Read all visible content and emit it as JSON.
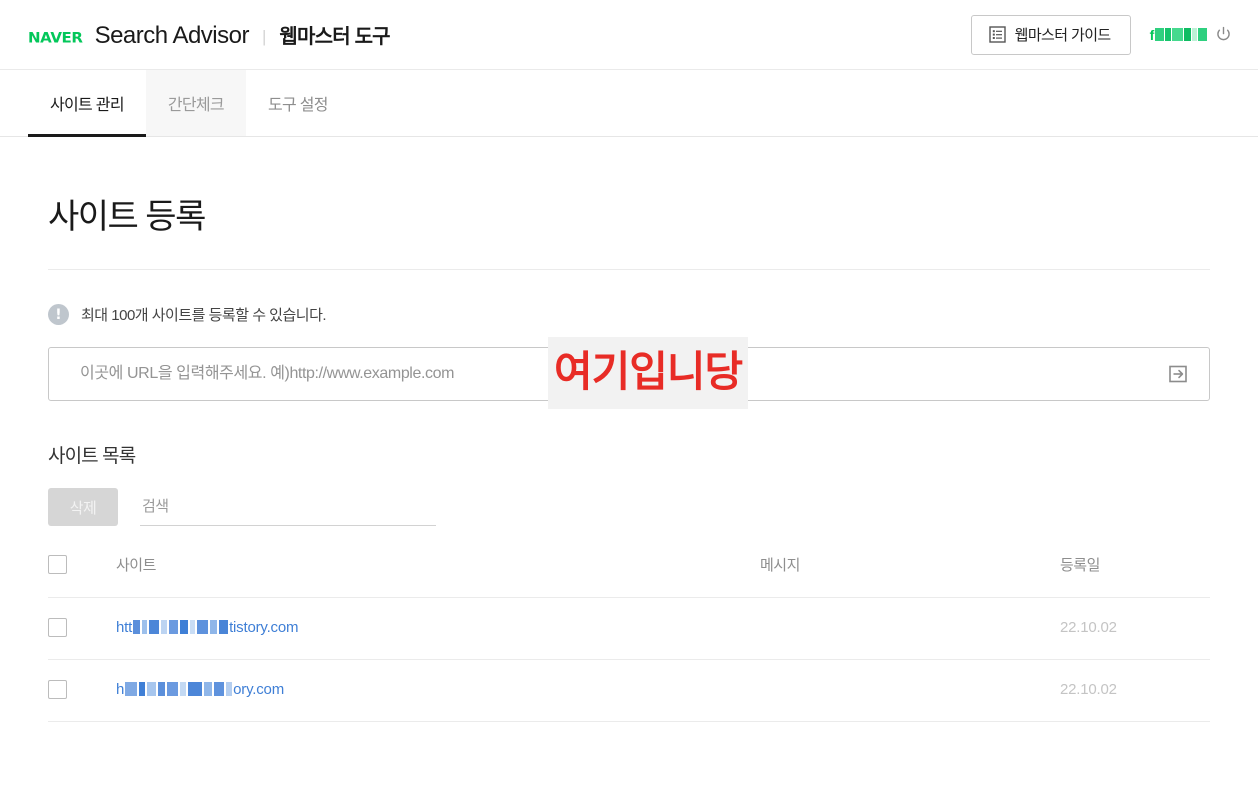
{
  "header": {
    "logo_text": "NAVER",
    "brand_title": "Search Advisor",
    "separator": "|",
    "brand_sub": "웹마스터 도구",
    "guide_button_label": "웹마스터 가이드",
    "guide_icon": "list-document-icon",
    "user_name_prefix": "f",
    "user_name_note": "censored",
    "logout_icon": "power-icon",
    "brand_color": "#03c75a"
  },
  "tabs": [
    {
      "label": "사이트 관리",
      "state": "active"
    },
    {
      "label": "간단체크",
      "state": "hovered"
    },
    {
      "label": "도구 설정",
      "state": "normal"
    }
  ],
  "main": {
    "page_title": "사이트 등록",
    "notice": {
      "icon": "exclamation-icon",
      "text": "최대 100개 사이트를 등록할 수 있습니다."
    },
    "url_input": {
      "value": "",
      "placeholder": "이곳에 URL을 입력해주세요. 예)http://www.example.com",
      "submit_icon": "arrow-into-box-icon"
    },
    "annotation": {
      "text": "여기입니당",
      "color": "#e82c26",
      "background": "#f2f2f2"
    }
  },
  "site_list": {
    "title": "사이트 목록",
    "delete_button": {
      "label": "삭제",
      "disabled": true
    },
    "search": {
      "value": "",
      "placeholder": "검색"
    },
    "columns": {
      "select_all": "select-all-checkbox",
      "site": "사이트",
      "message": "메시지",
      "date": "등록일"
    },
    "rows": [
      {
        "url": "htt██████████tistory.com",
        "message": "",
        "date": "22.10.02"
      },
      {
        "url": "h███████████████ory.com",
        "message": "",
        "date": "22.10.02"
      }
    ]
  }
}
